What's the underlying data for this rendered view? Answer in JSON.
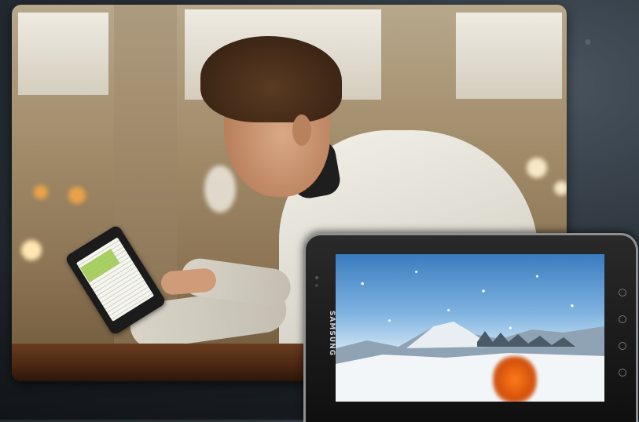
{
  "scene": {
    "description_free": true
  },
  "tablet": {
    "brand": "SAMSUNG"
  },
  "colors": {
    "background": "#2b333b",
    "card_warm": "#a08a68",
    "railing": "#4a2612",
    "jacket": "#d9d6cc",
    "reader_highlight": "#9bc94b",
    "sky": "#7fb3e0",
    "skier": "#ff7a1a"
  },
  "icons": [
    "back-button-icon",
    "menu-button-icon",
    "home-button-icon",
    "search-button-icon"
  ]
}
